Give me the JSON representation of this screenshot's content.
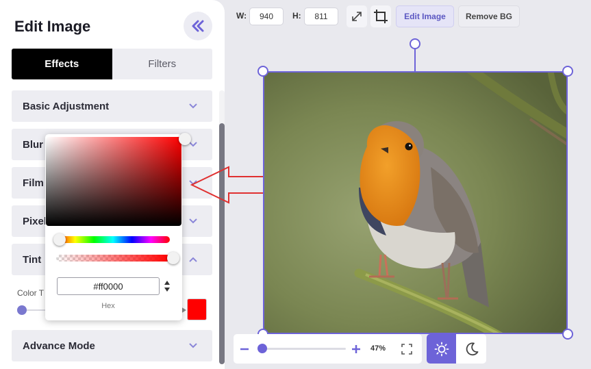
{
  "sidebar": {
    "title": "Edit Image",
    "tabs": [
      {
        "label": "Effects",
        "active": true
      },
      {
        "label": "Filters",
        "active": false
      }
    ],
    "sections": [
      {
        "label": "Basic Adjustment",
        "expanded": false
      },
      {
        "label": "Blur",
        "expanded": false
      },
      {
        "label": "Film",
        "expanded": false
      },
      {
        "label": "Pixel",
        "expanded": false
      },
      {
        "label": "Tint",
        "expanded": true
      },
      {
        "label": "Advance Mode",
        "expanded": false
      }
    ],
    "tint": {
      "color_label": "Color T",
      "swatch_color": "#ff0000"
    }
  },
  "color_picker": {
    "hex_value": "#ff0000",
    "mode_label": "Hex",
    "hue_color": "#ff0000"
  },
  "toolbar": {
    "width_label": "W:",
    "width_value": "940",
    "height_label": "H:",
    "height_value": "811",
    "edit_image_label": "Edit Image",
    "remove_bg_label": "Remove BG"
  },
  "zoom": {
    "value_label": "47%",
    "level_fraction": 0.05
  },
  "theme": {
    "active": "light"
  },
  "colors": {
    "accent": "#6d63d8",
    "tab_active_bg": "#000000",
    "annotation_arrow": "#e03030"
  },
  "icons": {
    "collapse": "double-chevron-left-icon",
    "expand": "chevron-down-icon",
    "expanded": "chevron-up-icon",
    "resize": "expand-arrows-icon",
    "crop": "crop-icon",
    "zoom_out": "minus-icon",
    "zoom_in": "plus-icon",
    "fit": "fullscreen-icon",
    "light": "sun-icon",
    "dark": "moon-icon"
  }
}
